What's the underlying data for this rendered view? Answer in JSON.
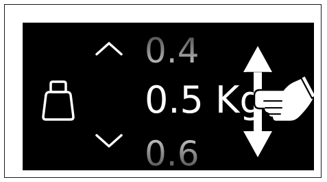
{
  "weight_selector": {
    "unit": "Kg",
    "values": {
      "previous": "0.4",
      "current": "0.5 Kg",
      "next": "0.6"
    },
    "icons": {
      "weight": "weight-icon",
      "increase": "chevron-up-icon",
      "decrease": "chevron-down-icon",
      "gesture_arrow": "vertical-swipe-arrow-icon",
      "gesture_hand": "pointing-hand-icon"
    },
    "colors": {
      "screen_background": "#000000",
      "current_value": "#ffffff",
      "adjacent_value": "#8e8e8e",
      "frame_border": "#1a1a1a"
    }
  }
}
